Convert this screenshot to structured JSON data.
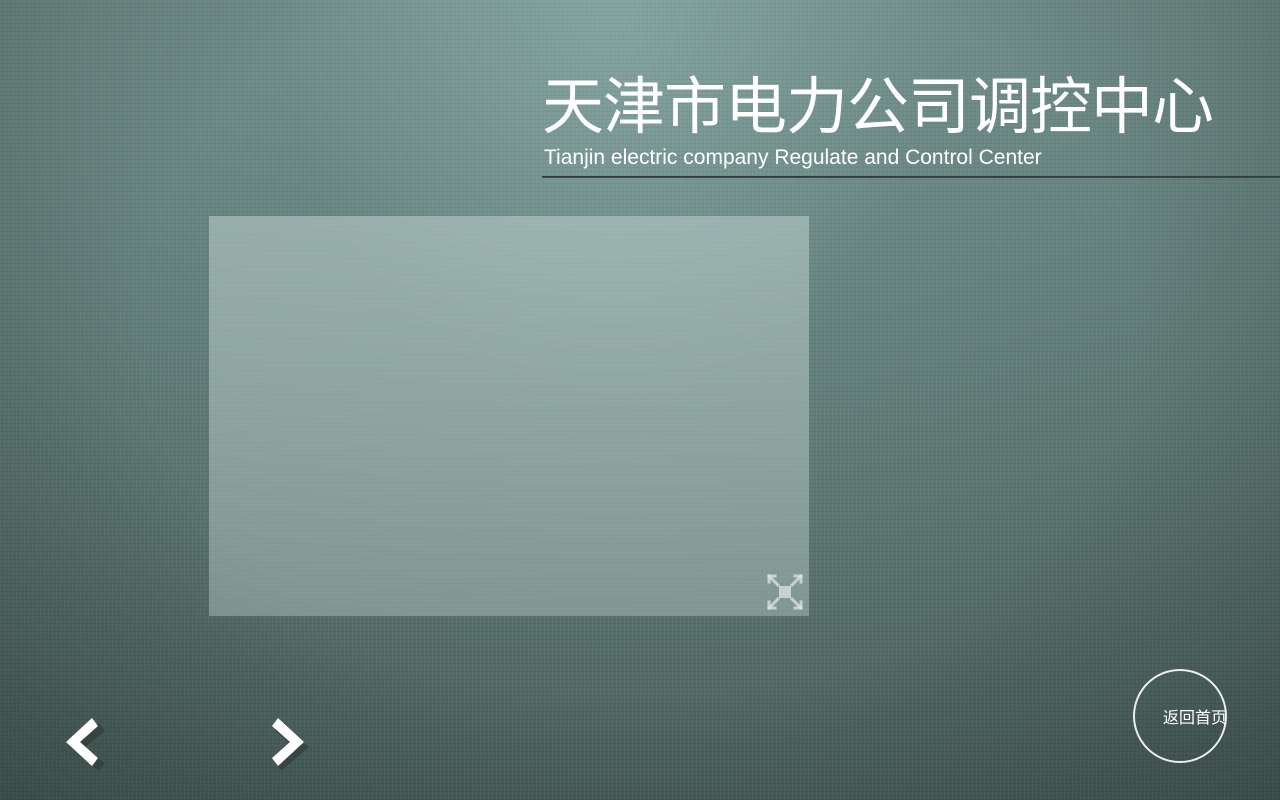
{
  "header": {
    "title_cn": "天津市电力公司调控中心",
    "title_en": "Tianjin electric company Regulate and Control Center"
  },
  "media_panel": {
    "fullscreen_icon": "fullscreen-expand-icon"
  },
  "navigation": {
    "prev_icon": "chevron-left-icon",
    "next_icon": "chevron-right-icon"
  },
  "home_button": {
    "label": "返回首页"
  },
  "colors": {
    "background": "#627d79",
    "text": "#ffffff",
    "panel": "#9fb2af",
    "rule": "#2e3d3a"
  }
}
